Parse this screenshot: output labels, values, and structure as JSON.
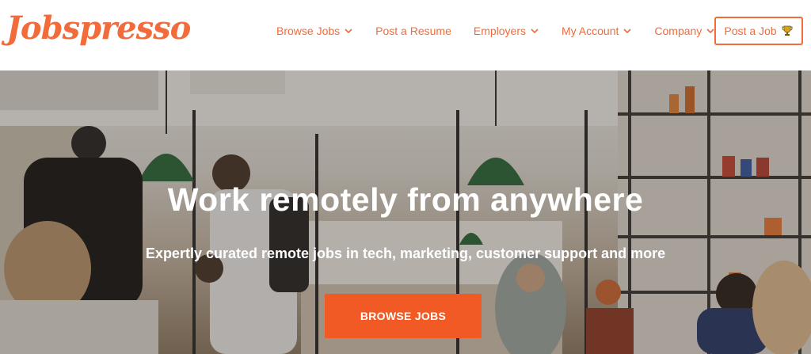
{
  "brand": {
    "logo_text": "Jobspresso",
    "accent": "#f26b3a",
    "button_color": "#f15a24"
  },
  "nav": {
    "items": [
      {
        "label": "Browse Jobs",
        "has_dropdown": true
      },
      {
        "label": "Post a Resume",
        "has_dropdown": false
      },
      {
        "label": "Employers",
        "has_dropdown": true
      },
      {
        "label": "My Account",
        "has_dropdown": true
      },
      {
        "label": "Company",
        "has_dropdown": true
      }
    ],
    "post_job_label": "Post a Job",
    "post_job_icon": "trophy-icon"
  },
  "hero": {
    "title": "Work remotely from anywhere",
    "subtitle": "Expertly curated remote jobs in tech, marketing, customer support and more",
    "cta_label": "BROWSE JOBS",
    "background_image": "cafe-interior-photo"
  }
}
